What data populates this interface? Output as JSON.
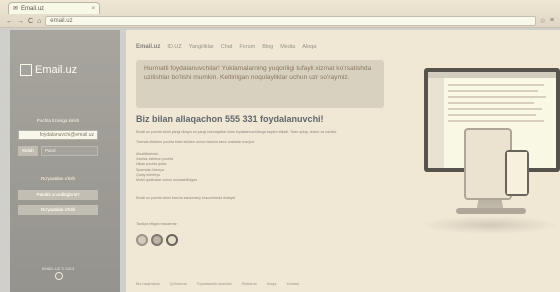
{
  "browser": {
    "tab_title": "Email.uz",
    "address": "email.uz"
  },
  "sidebar": {
    "logo_text": "Email.uz",
    "caption": "Pochta tizimiga kirish",
    "login_value": "foydalanuvchi@email.uz",
    "enter_button": "Kirish",
    "password_placeholder": "Parol",
    "links": [
      "Ro'yxatdan o'tish",
      "Parolni unutdingizmi?"
    ],
    "register_button": "Ro'yxatdan o'tish",
    "footer_text": "EMAIL.UZ © 2013"
  },
  "topnav": {
    "brand": "Email.uz",
    "items": [
      "ID.UZ",
      "Yangiliklar",
      "Chat",
      "Forum",
      "Blog",
      "Media",
      "Aloqa"
    ]
  },
  "notice": "Hurmatli foydalanuvchilar! Yuklamalarning yuqoriligi tufayli xizmat ko'rsatishda uzilishlar bo'lishi mumkin. Keltirilgan noqulayliklar uchun uzr so'raymiz.",
  "headline": "Biz bilan allaqachon 555 331 foydalanuvchi!",
  "paragraphs": [
    "Email.uz pochta tizimi yangi dizayn va yangi imkoniyatlar bilan foydalanuvchilarga taqdim etiladi. Tizim qulay, tezkor va xavfsiz.",
    "Tizimda elektron pochta bilan ishlash uchun barcha zarur vositalar mavjud."
  ],
  "list_title": "Afzalliklarimiz:",
  "list_items": [
    "Xavfsiz elektron pochta",
    "Ulkan pochta qutisi",
    "Spamdan himoya",
    "Qulay interfeys",
    "Mobil qurilmalar uchun moslashtirilgan"
  ],
  "paragraph_bottom": "Email.uz pochta tizimi barcha zamonaviy brauzerlarda ishlaydi.",
  "browser_note": "Tavsiya etilgan brauzerlar:",
  "browser_icons": [
    "chrome-icon",
    "firefox-icon",
    "opera-icon"
  ],
  "footer": [
    "Biz haqimizda",
    "Qo'llanma",
    "Foydalanish shartlari",
    "Reklama",
    "Aloqa",
    "Yordam"
  ]
}
